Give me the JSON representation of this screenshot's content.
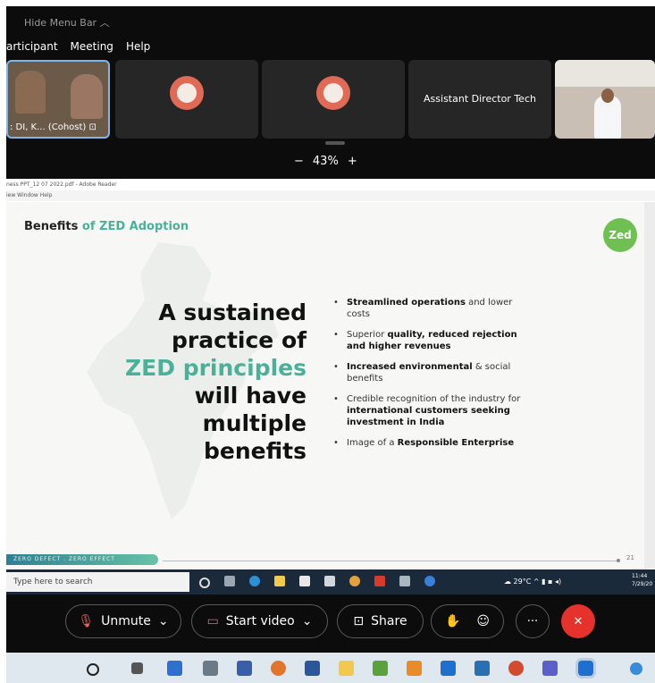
{
  "meeting": {
    "hide_menu_bar": "Hide Menu Bar",
    "menu": [
      "articipant",
      "Meeting",
      "Help"
    ],
    "tiles": [
      {
        "label": ": DI, K... (Cohost)"
      },
      {
        "label": ""
      },
      {
        "label": ""
      },
      {
        "label": "Assistant Director Tech"
      },
      {
        "label": ""
      }
    ],
    "zoom": {
      "minus": "−",
      "value": "43%",
      "plus": "+"
    }
  },
  "pdf": {
    "title": "ness PPT_12 07 2022.pdf - Adobe Reader",
    "menu": "iew   Window   Help"
  },
  "slide": {
    "title_plain": "Benefits",
    "title_accent": "of ZED Adoption",
    "logo": "Zed",
    "headline_1": "A sustained",
    "headline_2": "practice of",
    "headline_accent": "ZED principles",
    "headline_3": "will have",
    "headline_4": "multiple",
    "headline_5": "benefits",
    "benefits": [
      {
        "bold": "Streamlined operations",
        "rest": " and lower costs"
      },
      {
        "pre": "Superior ",
        "bold": "quality, reduced rejection and higher revenues"
      },
      {
        "bold": "Increased environmental",
        "rest": " & social benefits"
      },
      {
        "pre": "Credible recognition of the industry for ",
        "bold": "international customers seeking investment in India"
      },
      {
        "pre": "Image of a ",
        "bold": "Responsible Enterprise"
      }
    ],
    "footer_tag": "ZERO DEFECT . ZERO EFFECT",
    "page_number": "21"
  },
  "taskbar_inner": {
    "search_placeholder": "Type here to search",
    "weather": "29°C",
    "time": "11:44",
    "date": "7/29/20"
  },
  "controls": {
    "unmute": "Unmute",
    "start_video": "Start video",
    "share": "Share",
    "more": "···",
    "leave": "✕"
  },
  "colors": {
    "accent_green": "#4bb09a",
    "leave_red": "#e5322d"
  }
}
